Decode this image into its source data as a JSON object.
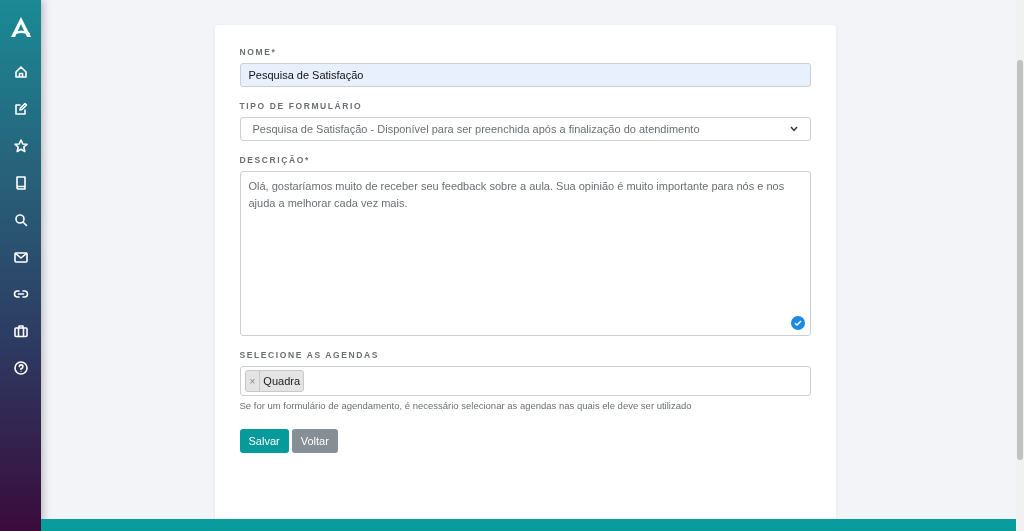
{
  "form": {
    "fields": [
      {
        "kind": "text",
        "label": "NOME*",
        "value": "Pesquisa de Satisfação",
        "autofilled": true
      },
      {
        "kind": "select",
        "label": "TIPO DE FORMULÁRIO",
        "value": "Pesquisa de Satisfação - Disponível para ser preenchida após a finalização do atendimento"
      },
      {
        "kind": "textarea",
        "label": "DESCRIÇÃO*",
        "value": "Olá, gostaríamos muito de receber seu feedback sobre a aula. Sua opinião é muito importante para nós e nos ajuda a melhorar cada vez mais."
      },
      {
        "kind": "tags",
        "label": "SELECIONE AS AGENDAS",
        "tags": [
          {
            "remove": "×",
            "label": "Quadra"
          }
        ],
        "help": "Se for um formulário de agendamento, é necessário selecionar as agendas nas quais ele deve ser utilizado"
      }
    ],
    "buttons": [
      {
        "kind": "primary",
        "label": "Salvar"
      },
      {
        "kind": "secondary",
        "label": "Voltar"
      }
    ]
  }
}
